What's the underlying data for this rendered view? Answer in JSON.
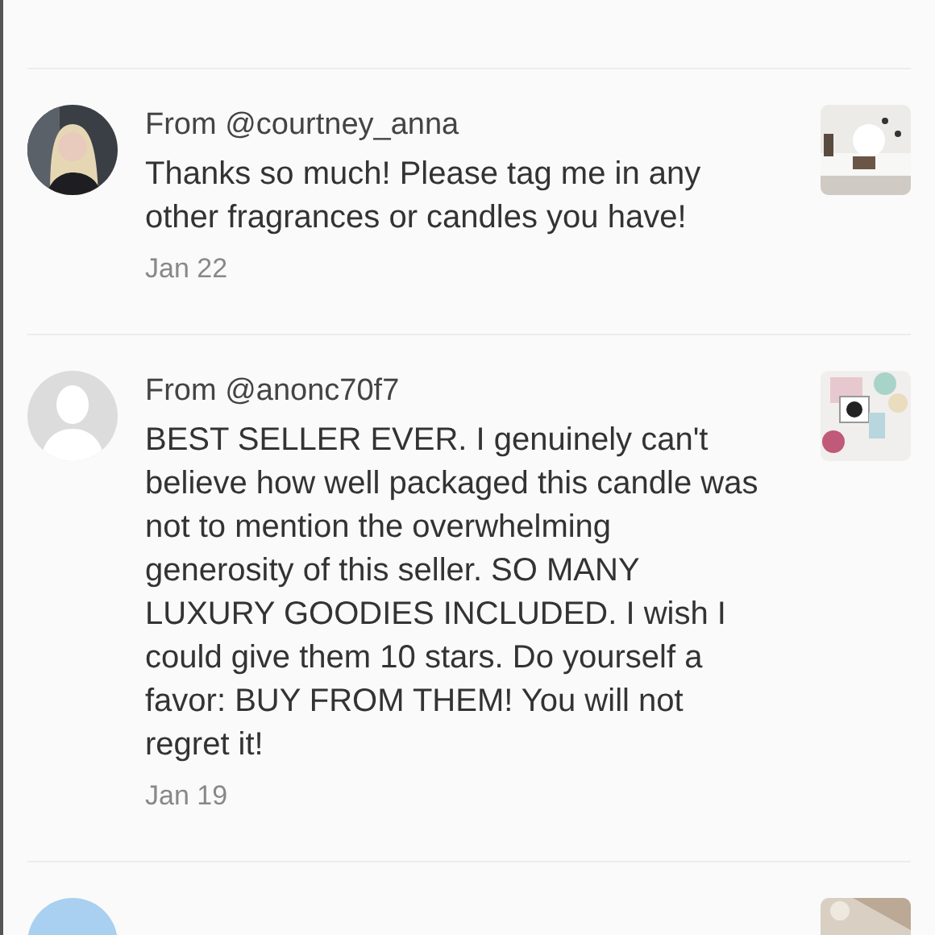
{
  "comments": [
    {
      "from": "From @courtney_anna",
      "message": "Thanks so much! Please tag me in any other fragrances or candles you have!",
      "date": "Jan 22"
    },
    {
      "from": "From @anonc70f7",
      "message": "BEST SELLER EVER. I genuinely can't believe how well packaged this candle was not to mention the overwhelming generosity of this seller. SO MANY LUXURY GOODIES INCLUDED. I wish I could give them 10 stars. Do yourself a favor: BUY FROM THEM! You will not regret it!",
      "date": "Jan 19",
      "avatar": {
        "kind": "default"
      }
    },
    {
      "avatar": {
        "kind": "plain"
      }
    }
  ]
}
